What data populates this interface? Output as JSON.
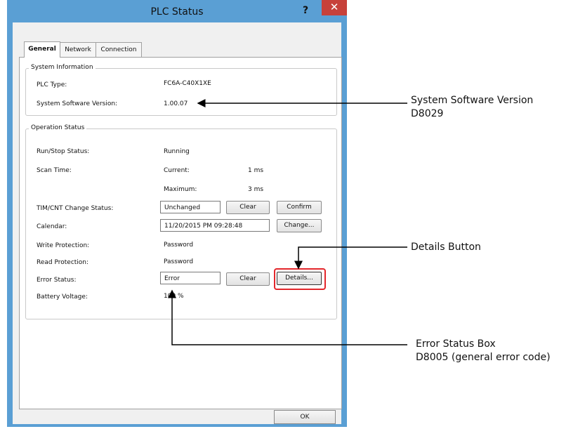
{
  "window": {
    "title": "PLC Status",
    "help": "?",
    "close": "✕"
  },
  "tabs": [
    {
      "label": "General"
    },
    {
      "label": "Network"
    },
    {
      "label": "Connection"
    }
  ],
  "system_info": {
    "title": "System Information",
    "plc_type_label": "PLC Type:",
    "plc_type_value": "FC6A-C40X1XE",
    "sw_version_label": "System Software Version:",
    "sw_version_value": "1.00.07"
  },
  "operation": {
    "title": "Operation Status",
    "run_stop_label": "Run/Stop Status:",
    "run_stop_value": "Running",
    "scan_time_label": "Scan Time:",
    "current_label": "Current:",
    "current_value": "1 ms",
    "maximum_label": "Maximum:",
    "maximum_value": "3 ms",
    "timcnt_label": "TIM/CNT Change Status:",
    "timcnt_value": "Unchanged",
    "clear_label": "Clear",
    "confirm_label": "Confirm",
    "calendar_label": "Calendar:",
    "calendar_value": "11/20/2015 PM 09:28:48",
    "change_label": "Change...",
    "write_prot_label": "Write Protection:",
    "write_prot_value": "Password",
    "read_prot_label": "Read Protection:",
    "read_prot_value": "Password",
    "error_label": "Error Status:",
    "error_value": "Error",
    "error_clear_label": "Clear",
    "details_label": "Details...",
    "battery_label": "Battery Voltage:",
    "battery_value": "100 %"
  },
  "footer": {
    "ok_label": "OK"
  },
  "callouts": {
    "sw_line1": "System Software Version",
    "sw_line2": "D8029",
    "details": "Details Button",
    "error_line1": "Error Status Box",
    "error_line2": "D8005 (general error code)"
  },
  "colors": {
    "title_bar": "#5a9fd4",
    "close_button": "#c7413a",
    "highlight": "#e3262b"
  }
}
